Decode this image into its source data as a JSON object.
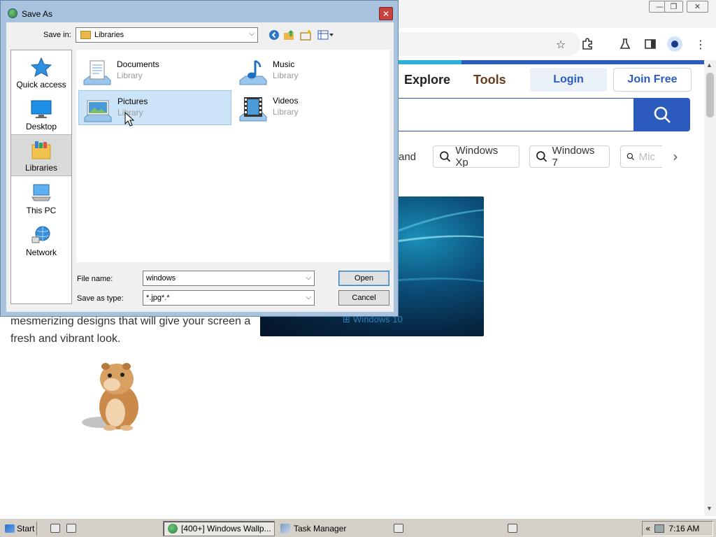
{
  "dialog": {
    "title": "Save As",
    "save_in_label": "Save in:",
    "save_in_value": "Libraries",
    "places": [
      {
        "label": "Quick access",
        "icon": "star-icon"
      },
      {
        "label": "Desktop",
        "icon": "desktop-icon"
      },
      {
        "label": "Libraries",
        "icon": "libraries-icon",
        "selected": true
      },
      {
        "label": "This PC",
        "icon": "computer-icon"
      },
      {
        "label": "Network",
        "icon": "network-icon"
      }
    ],
    "libraries": [
      {
        "name": "Documents",
        "type": "Library",
        "icon": "documents-library-icon"
      },
      {
        "name": "Music",
        "type": "Library",
        "icon": "music-library-icon"
      },
      {
        "name": "Pictures",
        "type": "Library",
        "icon": "pictures-library-icon",
        "selected": true
      },
      {
        "name": "Videos",
        "type": "Library",
        "icon": "videos-library-icon"
      }
    ],
    "file_name_label": "File name:",
    "file_name_value": "windows",
    "save_type_label": "Save as type:",
    "save_type_value": "*.jpg*.*",
    "open_button": "Open",
    "cancel_button": "Cancel"
  },
  "browser": {
    "nav": {
      "explore": "Explore",
      "tools": "Tools",
      "login": "Login",
      "join": "Join Free"
    },
    "chips": {
      "partial": "and",
      "items": [
        "Windows Xp",
        "Windows 7",
        "Mic"
      ]
    },
    "hero_caption": "Windows 10",
    "body_text": "mesmerizing designs that will give your screen a fresh and vibrant look."
  },
  "taskbar": {
    "start": "Start",
    "tasks": [
      {
        "label": "[400+] Windows Wallp...",
        "active": true
      },
      {
        "label": "Task Manager",
        "active": false
      }
    ],
    "clock": "7:16 AM"
  },
  "colors": {
    "accent_blue": "#2a5bbd",
    "dialog_frame": "#a9c2de",
    "selection": "#cce4f7"
  }
}
